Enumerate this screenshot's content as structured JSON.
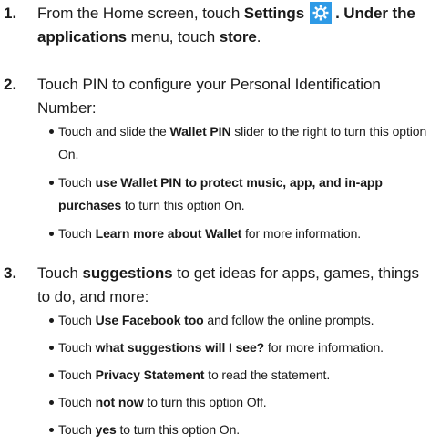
{
  "steps": [
    {
      "num": "1.",
      "p1": "From the Home screen, touch ",
      "b1": "Settings",
      "icon": "settings-gear-icon",
      "p2": ". Under the ",
      "b2": "applications",
      "p3": " menu, touch ",
      "b3": "store",
      "p4": "."
    },
    {
      "num": "2.",
      "text": "Touch PIN to configure your Personal Identification Number:",
      "bullets": [
        {
          "p1": "Touch and slide the ",
          "b1": "Wallet PIN",
          "p2": " slider to the right to turn this option On."
        },
        {
          "p1": "Touch ",
          "b1": "use Wallet PIN to protect music, app, and in-app purchases",
          "p2": " to turn this option On."
        },
        {
          "p1": "Touch ",
          "b1": "Learn more about Wallet",
          "p2": " for more information."
        }
      ]
    },
    {
      "num": "3.",
      "p1": "Touch ",
      "b1": "suggestions",
      "p2": " to get ideas for apps, games, things to do, and more:",
      "bullets": [
        {
          "p1": "Touch ",
          "b1": "Use Facebook too",
          "p2": " and follow the online prompts."
        },
        {
          "p1": "Touch ",
          "b1": "what suggestions will I see?",
          "p2": " for more information."
        },
        {
          "p1": "Touch ",
          "b1": "Privacy Statement",
          "p2": " to read the statement."
        },
        {
          "p1": "Touch ",
          "b1": "not now",
          "p2": " to turn this option Off."
        },
        {
          "p1": "Touch ",
          "b1": "yes",
          "p2": " to turn this option On."
        }
      ]
    }
  ],
  "colors": {
    "text": "#1a1a1a",
    "icon_bg": "#2e9ae6",
    "icon_fg": "#ffffff"
  }
}
